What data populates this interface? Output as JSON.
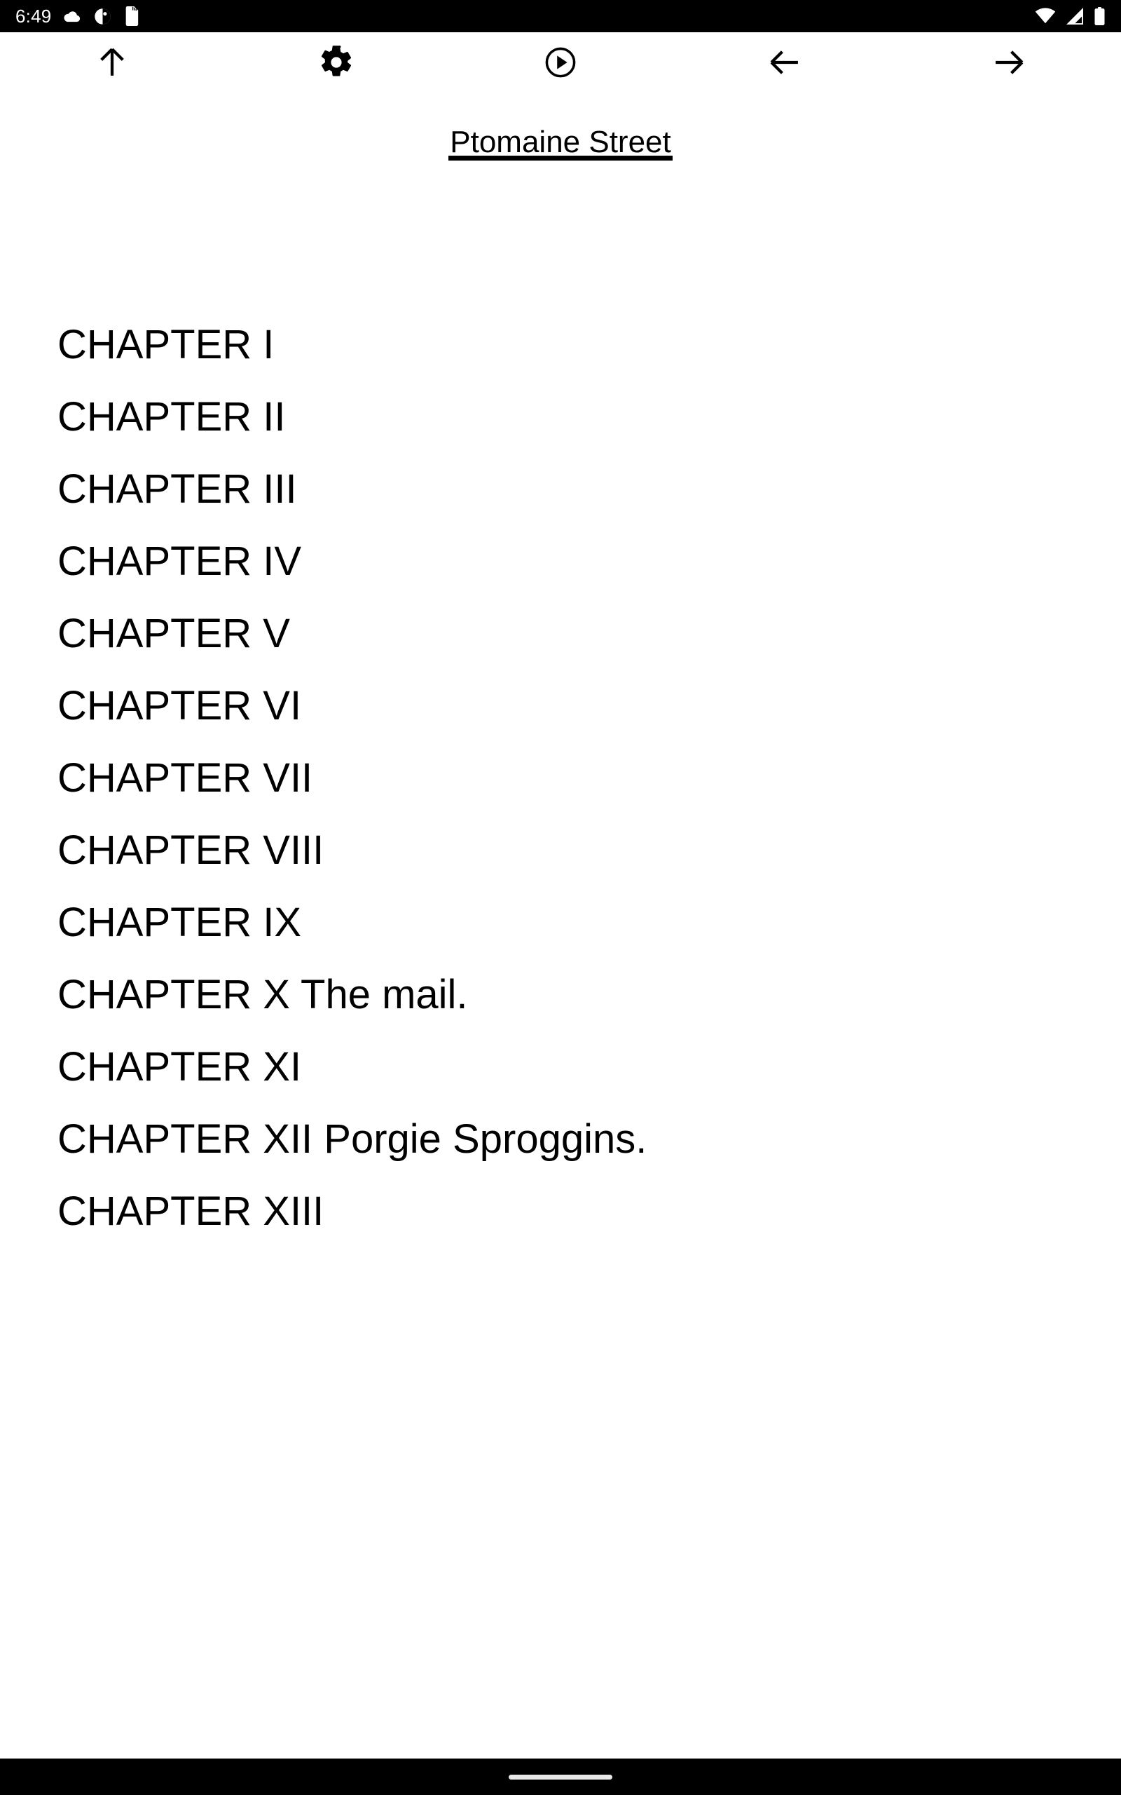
{
  "status_bar": {
    "clock": "6:49",
    "background": "#000000",
    "foreground": "#ffffff",
    "left_icons": [
      {
        "name": "cloud-icon"
      },
      {
        "name": "circle-contrast-icon"
      },
      {
        "name": "sd-card-icon"
      }
    ],
    "right_icons": [
      {
        "name": "wifi-icon"
      },
      {
        "name": "cellular-signal-icon"
      },
      {
        "name": "battery-icon"
      }
    ]
  },
  "toolbar": {
    "background": "#ffffff",
    "icon_color": "#000000",
    "buttons": [
      {
        "name": "scroll-to-top-button",
        "icon": "arrow-up-icon"
      },
      {
        "name": "settings-button",
        "icon": "gear-icon"
      },
      {
        "name": "play-button",
        "icon": "play-circle-icon"
      },
      {
        "name": "back-button",
        "icon": "arrow-left-icon"
      },
      {
        "name": "forward-button",
        "icon": "arrow-right-icon"
      }
    ]
  },
  "book": {
    "title": "Ptomaine Street"
  },
  "contents": {
    "chapters": [
      "CHAPTER I",
      "CHAPTER II",
      "CHAPTER III",
      "CHAPTER IV",
      "CHAPTER V",
      "CHAPTER VI",
      "CHAPTER VII",
      "CHAPTER VIII",
      "CHAPTER IX",
      "CHAPTER X The mail.",
      "CHAPTER XI",
      "CHAPTER XII Porgie Sproggins.",
      "CHAPTER XIII"
    ]
  },
  "nav_bar": {
    "background": "#000000",
    "gesture_pill_color": "#e8e8e8"
  }
}
